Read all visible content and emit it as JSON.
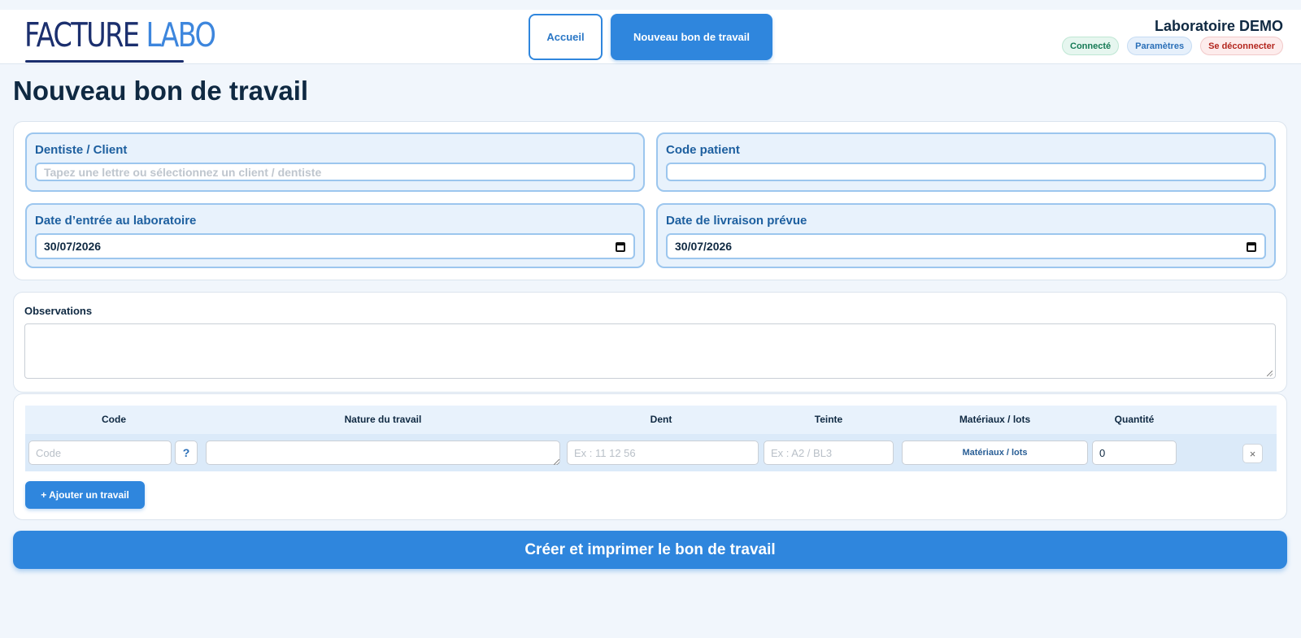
{
  "header": {
    "logo": {
      "word1": "FACTURE",
      "word2": "LABO"
    },
    "nav": {
      "home": "Accueil",
      "new_order": "Nouveau bon de travail"
    },
    "lab_name": "Laboratoire DEMO",
    "status": "Connecté",
    "settings": "Paramètres",
    "logout": "Se déconnecter"
  },
  "page": {
    "title": "Nouveau bon de travail"
  },
  "form": {
    "client": {
      "label": "Dentiste / Client",
      "placeholder": "Tapez une lettre ou sélectionnez un client / dentiste",
      "value": ""
    },
    "patient": {
      "label": "Code patient",
      "value": ""
    },
    "entry_date": {
      "label": "Date d’entrée au laboratoire",
      "value": "30/07/2026"
    },
    "delivery_date": {
      "label": "Date de livraison prévue",
      "value": "30/07/2026"
    },
    "observations": {
      "label": "Observations",
      "value": ""
    }
  },
  "table": {
    "headers": {
      "code": "Code",
      "nature": "Nature du travail",
      "tooth": "Dent",
      "shade": "Teinte",
      "materials": "Matériaux / lots",
      "quantity": "Quantité"
    },
    "rows": [
      {
        "code_placeholder": "Code",
        "help_label": "?",
        "nature": "",
        "tooth_placeholder": "Ex : 11 12 56",
        "shade_placeholder": "Ex : A2 / BL3",
        "materials_label": "Matériaux / lots",
        "quantity": "0",
        "delete_label": "×"
      }
    ],
    "add_button": "+ Ajouter un travail"
  },
  "submit_button": "Créer et imprimer le bon de travail",
  "colors": {
    "primary": "#2f86dd",
    "navy": "#0f2942",
    "field_bg": "#e8f2fc",
    "field_border": "#9cc6ee"
  },
  "icons": {
    "calendar": "calendar-icon",
    "delete": "close-icon",
    "help": "question-icon"
  }
}
